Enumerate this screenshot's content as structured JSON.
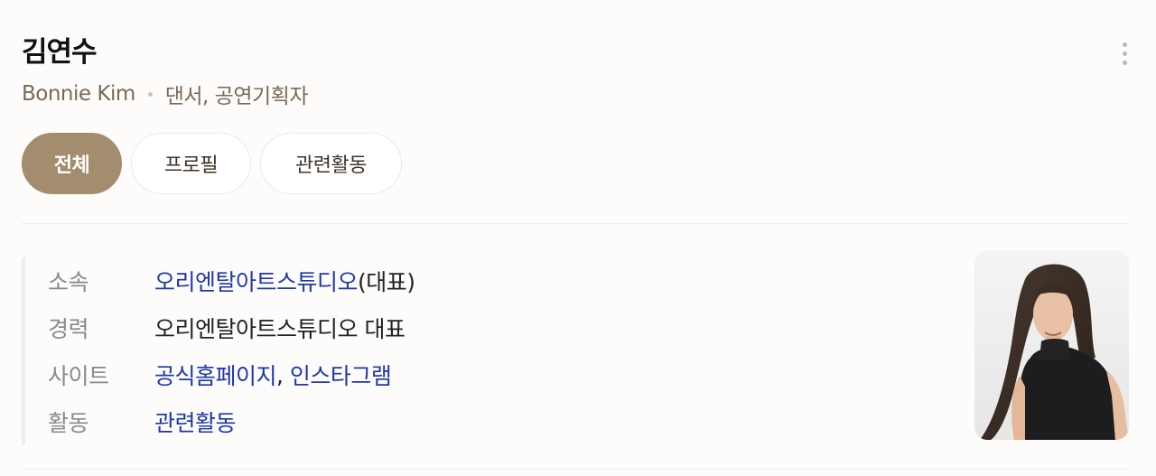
{
  "profile": {
    "name": "김연수",
    "english_name": "Bonnie Kim",
    "occupation": "댄서, 공연기획자"
  },
  "menu": {
    "icon": "more-vertical-icon"
  },
  "tabs": [
    {
      "label": "전체",
      "active": true
    },
    {
      "label": "프로필",
      "active": false
    },
    {
      "label": "관련활동",
      "active": false
    }
  ],
  "info": {
    "affiliation": {
      "label": "소속",
      "link": "오리엔탈아트스튜디오",
      "suffix": "(대표)"
    },
    "career": {
      "label": "경력",
      "value": "오리엔탈아트스튜디오 대표"
    },
    "site": {
      "label": "사이트",
      "link1": "공식홈페이지",
      "separator": ", ",
      "link2": "인스타그램"
    },
    "activity": {
      "label": "활동",
      "link": "관련활동"
    }
  },
  "photo": {
    "alt": "김연수 프로필 사진"
  },
  "colors": {
    "accent": "#a48c6f",
    "link": "#1e39a6",
    "subtext": "#7a6a54"
  }
}
